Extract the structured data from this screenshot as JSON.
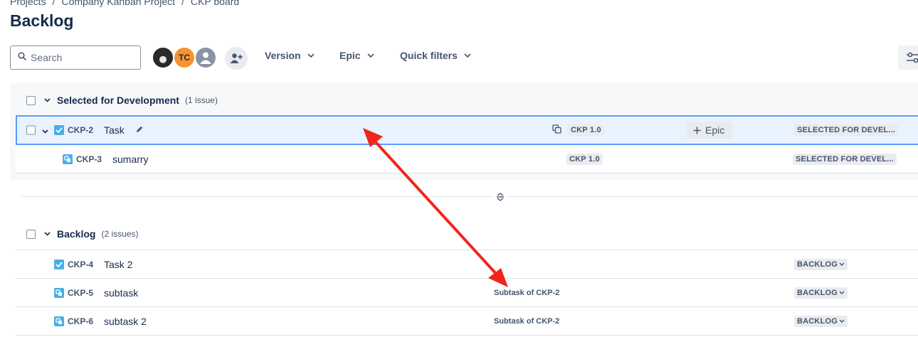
{
  "breadcrumb": {
    "items": [
      "Projects",
      "Company Kanban Project",
      "CKP board"
    ]
  },
  "page": {
    "title": "Backlog"
  },
  "toolbar": {
    "search_placeholder": "Search",
    "avatars": [
      {
        "initials": ""
      },
      {
        "initials": "TC"
      },
      {
        "initials": ""
      }
    ],
    "filters": {
      "version": "Version",
      "epic": "Epic",
      "quick": "Quick filters"
    }
  },
  "sprint": {
    "name": "Selected for Development",
    "count": "(1 issue)",
    "rows": [
      {
        "key": "CKP-2",
        "summary": "Task",
        "type": "task",
        "version": "CKP 1.0",
        "epic_label": "Epic",
        "status": "SELECTED FOR DEVEL..."
      },
      {
        "key": "CKP-3",
        "summary": "sumarry",
        "type": "subtask",
        "version": "CKP 1.0",
        "status": "SELECTED FOR DEVEL..."
      }
    ]
  },
  "backlog": {
    "name": "Backlog",
    "count": "(2 issues)",
    "rows": [
      {
        "key": "CKP-4",
        "summary": "Task 2",
        "type": "task",
        "parent": "",
        "status": "BACKLOG"
      },
      {
        "key": "CKP-5",
        "summary": "subtask",
        "type": "subtask",
        "parent": "Subtask of CKP-2",
        "status": "BACKLOG"
      },
      {
        "key": "CKP-6",
        "summary": "subtask 2",
        "type": "subtask",
        "parent": "Subtask of CKP-2",
        "status": "BACKLOG"
      }
    ]
  },
  "colors": {
    "accent": "#579dff",
    "selected_bg": "#e9f2ff",
    "annotation_arrow": "#f0261c",
    "orange_avatar": "#f79232"
  }
}
